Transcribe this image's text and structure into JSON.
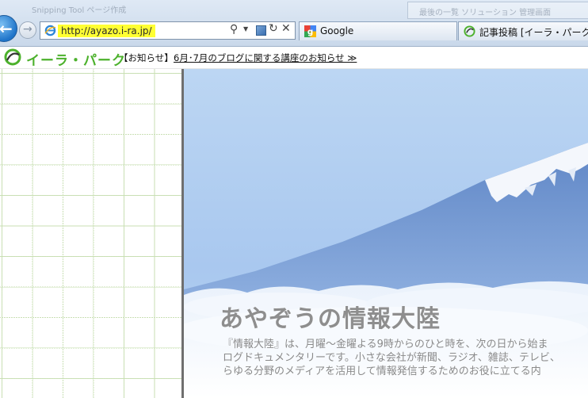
{
  "browser": {
    "title_strip_left": "Snipping Tool ページ作成",
    "title_strip_right": "最後の一覧 ソリューション 管理画面",
    "address": {
      "url": "http://ayazo.i-ra.jp/"
    },
    "tabs": [
      {
        "label": "Google"
      },
      {
        "label": "記事投稿 [イーラ・パーク"
      }
    ]
  },
  "site": {
    "logo_text": "イーラ・パーク",
    "notice_label": "【お知らせ】",
    "notice_link": "6月･7月のブログに関する講座のお知らせ ≫"
  },
  "hero": {
    "title": "あやぞうの情報大陸",
    "lines": [
      "『情報大陸』は、月曜～金曜よる9時からのひと時を、次の日から始ま",
      "ログドキュメンタリーです。小さな会社が新聞、ラジオ、雑誌、テレビ、",
      "らゆる分野のメディアを活用して情報発信するためのお役に立てる内"
    ]
  }
}
